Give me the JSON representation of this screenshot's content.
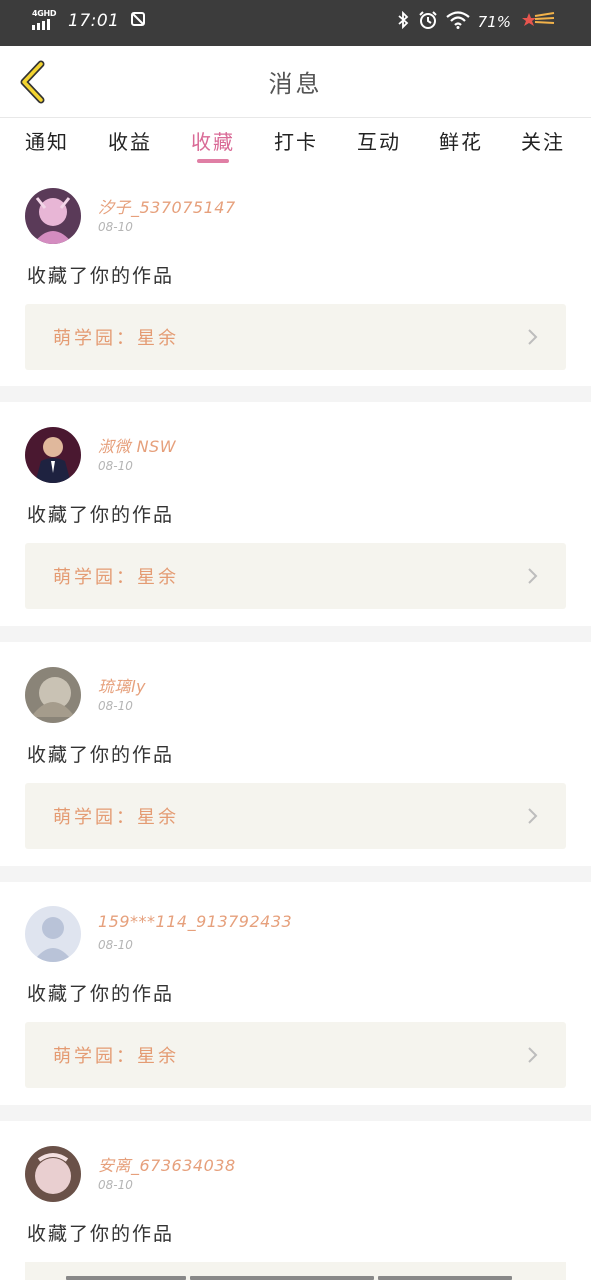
{
  "status_bar": {
    "network": "4GHD",
    "time": "17:01",
    "battery": "71%"
  },
  "header": {
    "title": "消息"
  },
  "tabs": [
    {
      "label": "通知",
      "active": false
    },
    {
      "label": "收益",
      "active": false
    },
    {
      "label": "收藏",
      "active": true
    },
    {
      "label": "打卡",
      "active": false
    },
    {
      "label": "互动",
      "active": false
    },
    {
      "label": "鲜花",
      "active": false
    },
    {
      "label": "关注",
      "active": false
    }
  ],
  "messages": [
    {
      "username": "汐子_537075147",
      "date": "08-10",
      "action": "收藏了你的作品",
      "work": "萌学园：星余"
    },
    {
      "username": "淑微 NSW",
      "date": "08-10",
      "action": "收藏了你的作品",
      "work": "萌学园：星余"
    },
    {
      "username": "琉璃ly",
      "date": "08-10",
      "action": "收藏了你的作品",
      "work": "萌学园：星余"
    },
    {
      "username": "159***114_913792433",
      "date": "08-10",
      "action": "收藏了你的作品",
      "work": "萌学园：星余"
    },
    {
      "username": "安离_673634038",
      "date": "08-10",
      "action": "收藏了你的作品",
      "work": ""
    }
  ],
  "colors": {
    "accent_pink": "#d96a96",
    "username_orange": "#e6a07c",
    "work_bg": "#f5f4ee",
    "back_icon_yellow": "#f3d431"
  },
  "icons": [
    "back-chevron-icon",
    "chevron-right-icon",
    "bluetooth-icon",
    "alarm-icon",
    "wifi-icon",
    "shooting-star-icon",
    "signal-icon",
    "sim-icon"
  ]
}
